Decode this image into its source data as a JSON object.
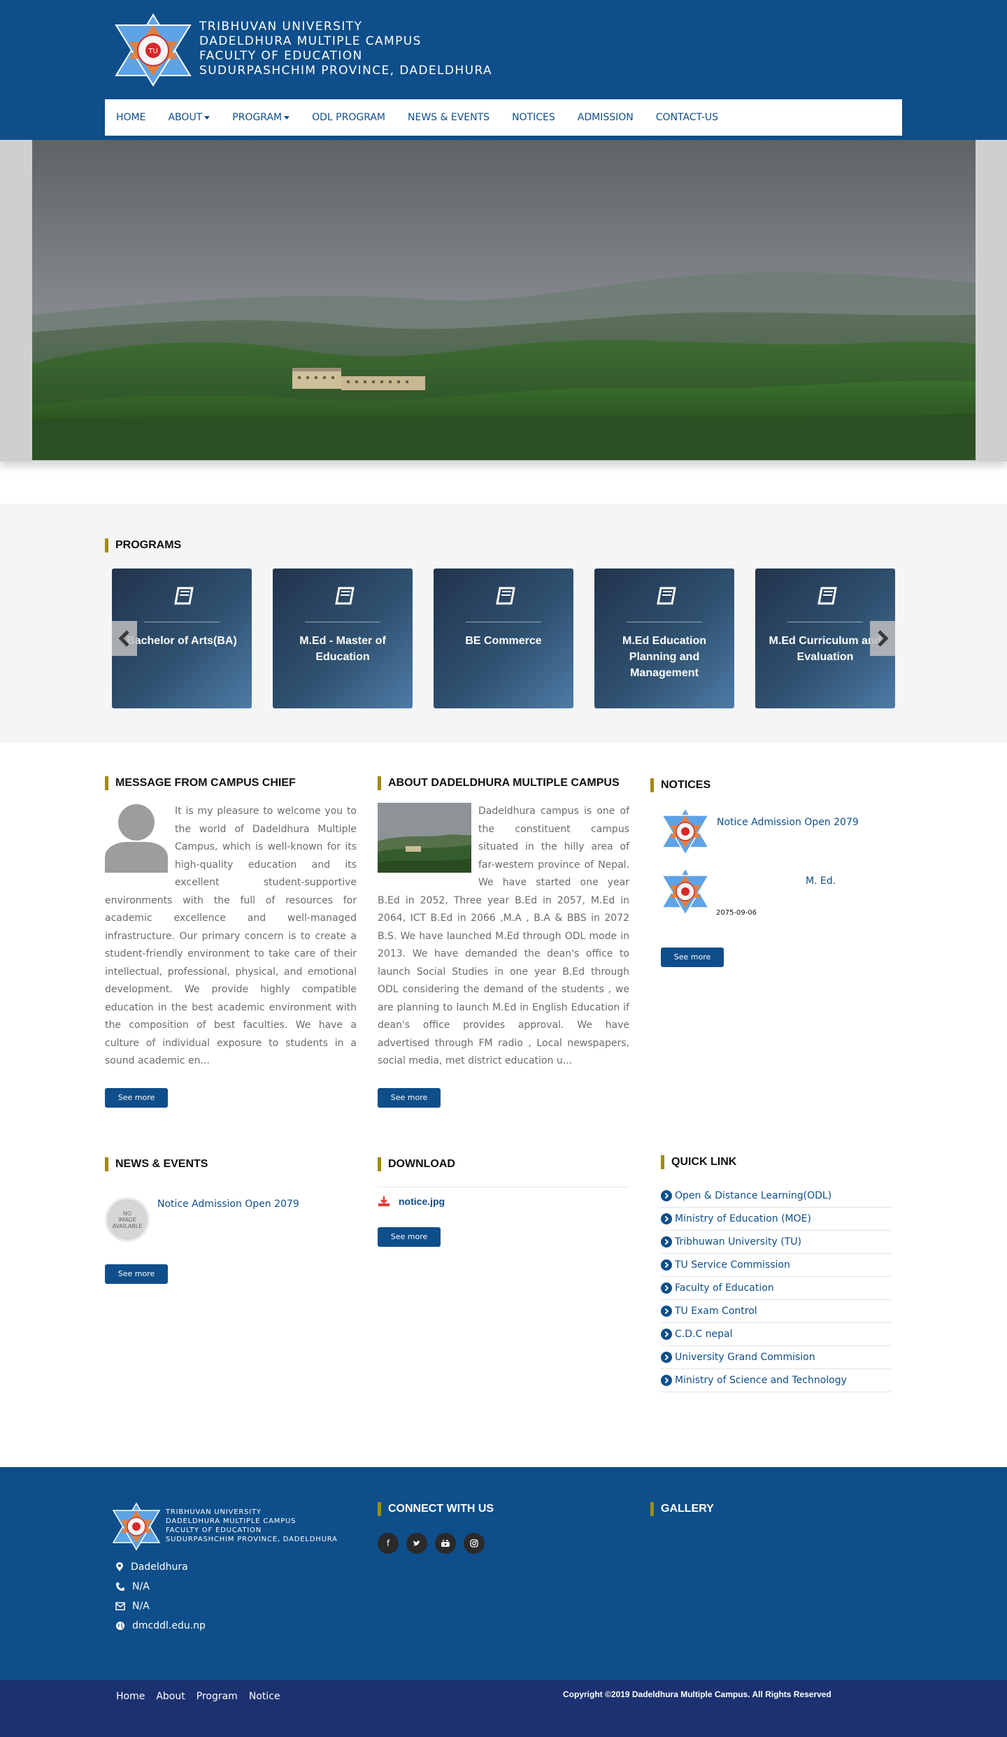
{
  "header": {
    "logo_text": [
      "TRIBHUVAN UNIVERSITY",
      "DADELDHURA MULTIPLE CAMPUS",
      "FACULTY OF EDUCATION",
      "SUDURPASHCHIM PROVINCE, DADELDHURA"
    ]
  },
  "nav": {
    "items": [
      {
        "label": "HOME",
        "dropdown": false
      },
      {
        "label": "ABOUT",
        "dropdown": true
      },
      {
        "label": "PROGRAM",
        "dropdown": true
      },
      {
        "label": "ODL PROGRAM",
        "dropdown": false
      },
      {
        "label": "NEWS & EVENTS",
        "dropdown": false
      },
      {
        "label": "NOTICES",
        "dropdown": false
      },
      {
        "label": "ADMISSION",
        "dropdown": false
      },
      {
        "label": "CONTACT-US",
        "dropdown": false
      }
    ]
  },
  "programs": {
    "title": "PROGRAMS",
    "cards": [
      {
        "name": "Bachelor of Arts(BA)"
      },
      {
        "name": "M.Ed - Master of Education"
      },
      {
        "name": "BE Commerce"
      },
      {
        "name": "M.Ed Education Planning and Management"
      },
      {
        "name": "M.Ed Curriculum and Evaluation"
      }
    ],
    "icon": "book-icon"
  },
  "chief": {
    "title": "MESSAGE FROM CAMPUS CHIEF",
    "text": "It is my pleasure to welcome you to the world of Dadeldhura Multiple Campus, which is well-known for its high-quality education and its excellent student-supportive environments with the full of resources for academic excellence and well-managed infrastructure. Our primary concern is to create a student-friendly environment to take care of their intellectual, professional, physical, and emotional development. We provide highly compatible education in the best academic environment with the composition of best faculties. We have a culture of individual exposure to students in a sound academic en...",
    "see_more": "See more"
  },
  "about": {
    "title": "ABOUT DADELDHURA MULTIPLE CAMPUS",
    "text": "Dadeldhura campus is one of the constituent campus situated in the hilly area of far-western province of Nepal. We have started one year B.Ed in 2052, Three year B.Ed in 2057, M.Ed in 2064, ICT B.Ed in 2066 ,M.A , B.A & BBS in 2072 B.S. We have launched M.Ed through ODL mode in 2013. We have demanded the dean's office to launch Social Studies in one year B.Ed through ODL considering the demand of the students , we are planning to launch M.Ed in English Education if dean's office provides approval. We have advertised through FM radio , Local newspapers, social media, met district  education u...",
    "see_more": "See more"
  },
  "notices": {
    "title": "NOTICES",
    "items": [
      {
        "title": "Notice Admission Open 2079",
        "date": ""
      },
      {
        "title": "M. Ed.",
        "date": "2075-09-06"
      }
    ],
    "see_more": "See more"
  },
  "news": {
    "title": "NEWS & EVENTS",
    "items": [
      {
        "title": "Notice Admission Open 2079"
      }
    ],
    "no_image": [
      "NO",
      "IMAGE",
      "AVAILABLE"
    ],
    "see_more": "See more"
  },
  "download": {
    "title": "DOWNLOAD",
    "items": [
      {
        "file": "notice.jpg"
      }
    ],
    "see_more": "See more"
  },
  "quick_links": {
    "title": "QUICK LINK",
    "items": [
      "Open & Distance Learning(ODL)",
      "Ministry of Education (MOE)",
      "Tribhuwan University (TU)",
      "TU Service Commission",
      "Faculty of Education",
      "TU Exam Control",
      "C.D.C nepal",
      "University Grand Commision",
      "Ministry of Science and Technology"
    ]
  },
  "footer": {
    "logo_text": [
      "TRIBHUVAN UNIVERSITY",
      "DADELDHURA MULTIPLE CAMPUS",
      "FACULTY OF EDUCATION",
      "SUDURPASHCHIM PROVINCE, DADELDHURA"
    ],
    "contact": {
      "location": "Dadeldhura",
      "phone": "N/A",
      "email": "N/A",
      "website": "dmcddl.edu.np"
    },
    "connect_title": "CONNECT WITH US",
    "social": [
      "facebook-icon",
      "twitter-icon",
      "youtube-icon",
      "instagram-icon"
    ],
    "gallery_title": "GALLERY",
    "bottom_links": [
      "Home",
      "About",
      "Program",
      "Notice"
    ],
    "copyright": "Copyright ©2019 Dadeldhura Multiple Campus. All Rights Reserved"
  },
  "colors": {
    "primary": "#0e4e8a",
    "accent_bar": "#a08a14",
    "footer_bottom": "#1c3170",
    "card_gradient_dark": "#22344c",
    "card_gradient_light": "#4e7ba7"
  }
}
